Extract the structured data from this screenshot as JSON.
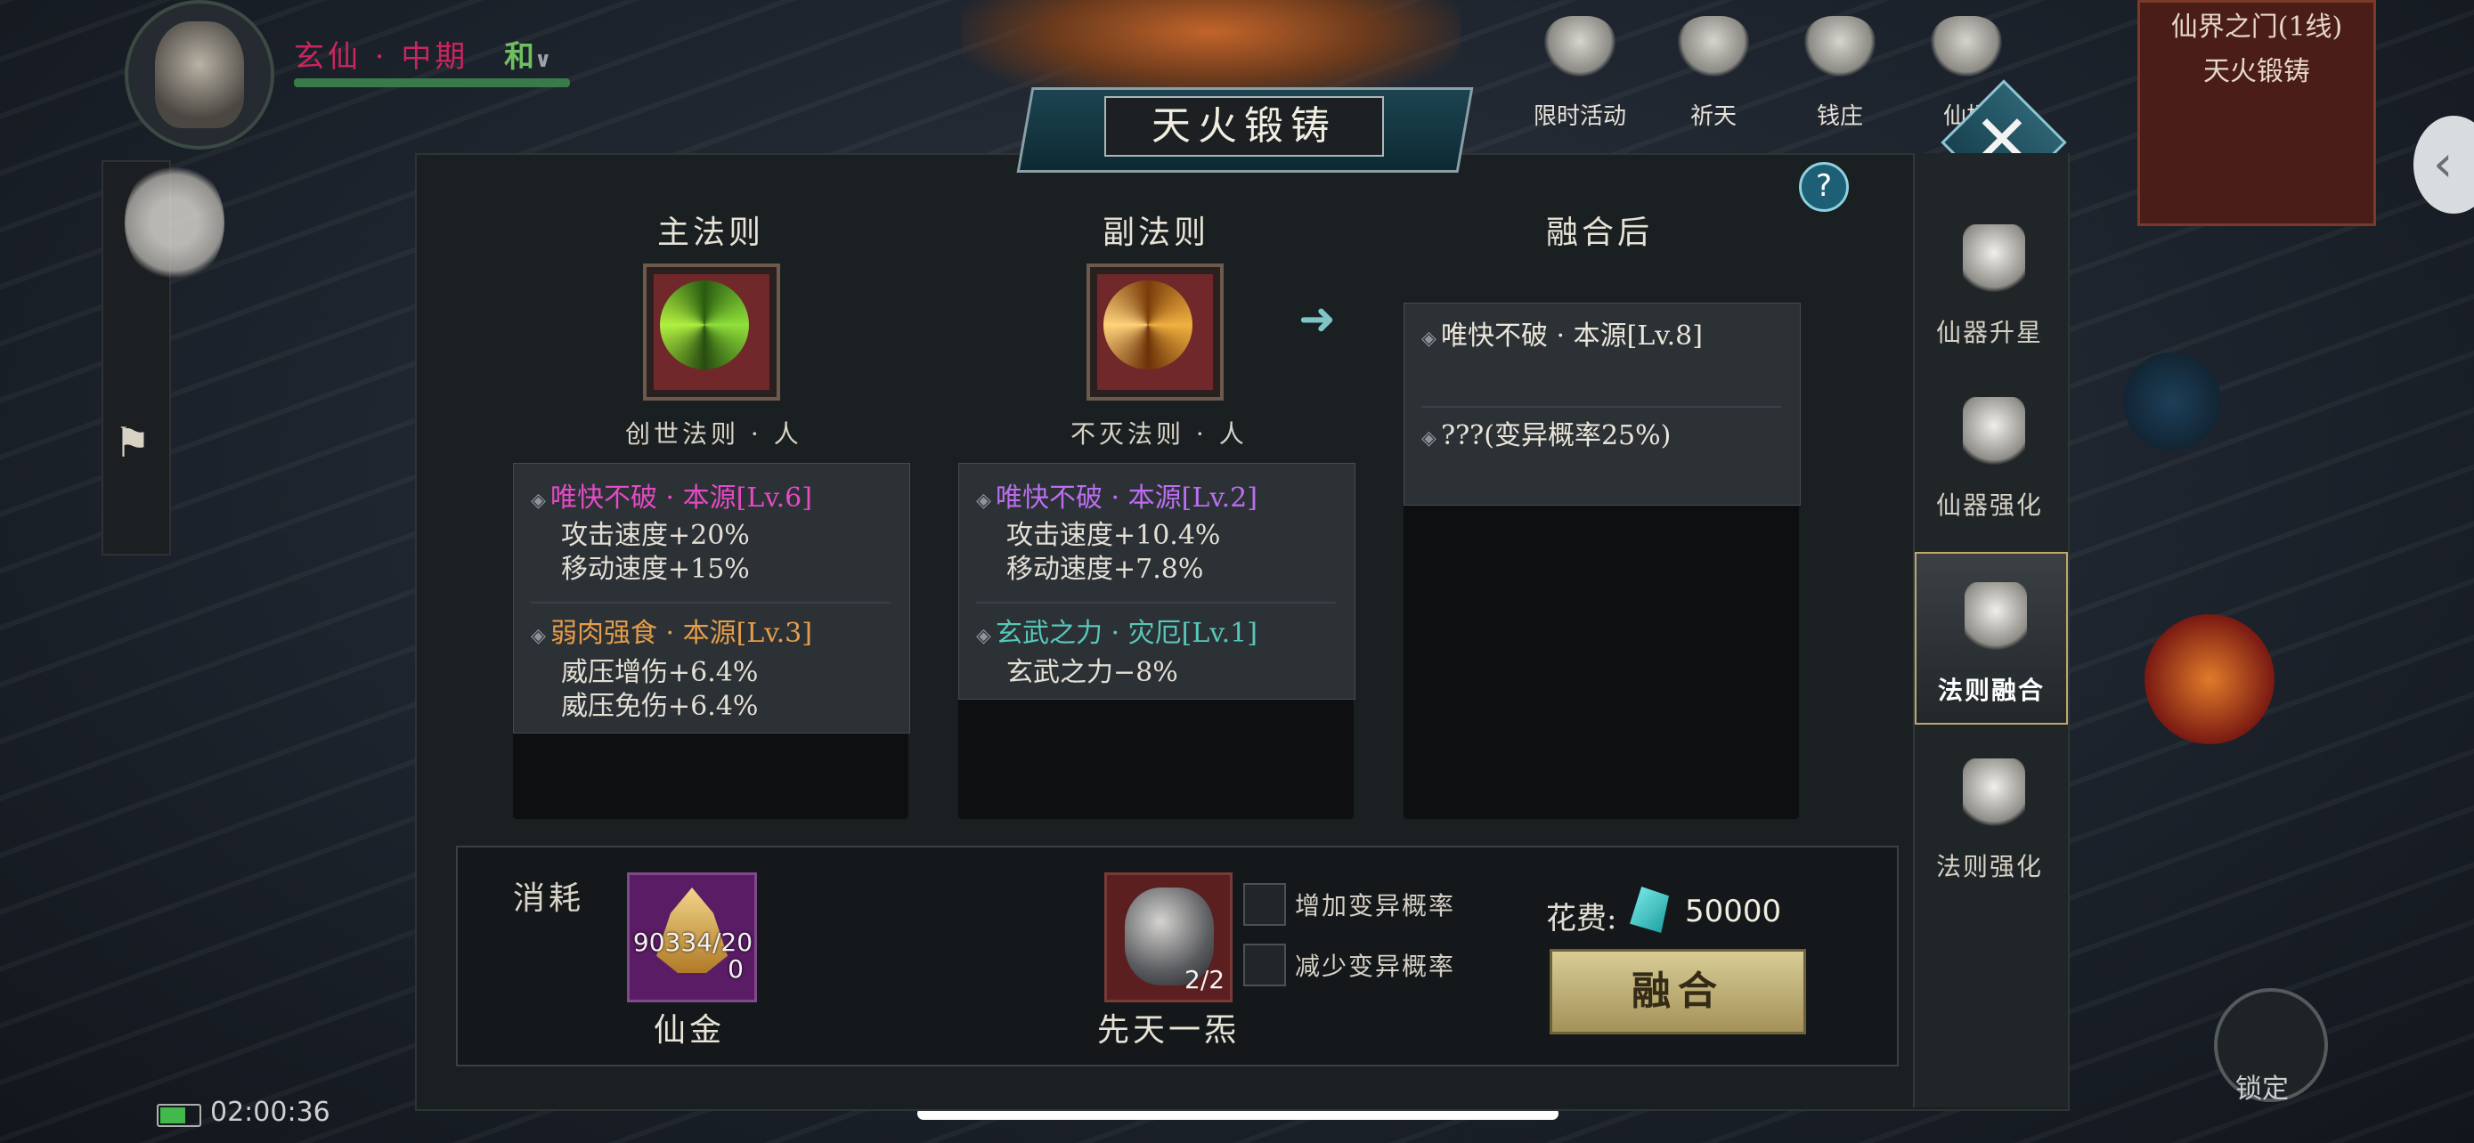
{
  "player": {
    "realm": "玄仙 · 中期",
    "mode": "和"
  },
  "top_icons": [
    {
      "name": "limited-event-icon",
      "label": "限时活动"
    },
    {
      "name": "pray-icon",
      "label": "祈天"
    },
    {
      "name": "shop-icon",
      "label": "钱庄"
    },
    {
      "name": "immortal-icon",
      "label": "仙楼"
    }
  ],
  "gate": {
    "line1": "仙界之门(1线)",
    "line2": "天火锻铸"
  },
  "dialog": {
    "title": "天火锻铸",
    "help": "?",
    "close": "✕",
    "columns": {
      "main": {
        "title": "主法则",
        "skill_name": "创世法则 · 人",
        "entries": [
          {
            "head": "唯快不破 · 本源[Lv.6]",
            "color": "#e44ac4",
            "lines": [
              "攻击速度+20%",
              "移动速度+15%"
            ]
          },
          {
            "head": "弱肉强食 · 本源[Lv.3]",
            "color": "#e59d4a",
            "lines": [
              "威压增伤+6.4%",
              "威压免伤+6.4%"
            ]
          }
        ]
      },
      "sub": {
        "title": "副法则",
        "skill_name": "不灭法则 · 人",
        "entries": [
          {
            "head": "唯快不破 · 本源[Lv.2]",
            "color": "#bb6ef0",
            "lines": [
              "攻击速度+10.4%",
              "移动速度+7.8%"
            ]
          },
          {
            "head": "玄武之力 · 灾厄[Lv.1]",
            "color": "#57c7b9",
            "lines": [
              "玄武之力−8%"
            ]
          }
        ]
      },
      "result": {
        "title": "融合后",
        "entries": [
          {
            "head": "唯快不破 · 本源[Lv.8]"
          },
          {
            "head": "???(变异概率25%)"
          }
        ]
      }
    },
    "consume": {
      "label": "消耗",
      "gold": {
        "name": "仙金",
        "count_line1": "90334/20",
        "count_line2": "0"
      },
      "stone": {
        "name": "先天一炁",
        "count": "2/2"
      },
      "options": [
        "增加变异概率",
        "减少变异概率"
      ],
      "cost_label": "花费:",
      "cost_value": "50000",
      "fuse_button": "融合"
    }
  },
  "sidebar": [
    {
      "name": "artifact-star-up",
      "label": "仙器升星",
      "active": false
    },
    {
      "name": "artifact-strengthen",
      "label": "仙器强化",
      "active": false
    },
    {
      "name": "law-fusion",
      "label": "法则融合",
      "active": true
    },
    {
      "name": "law-strengthen",
      "label": "法则强化",
      "active": false
    }
  ],
  "status": {
    "time": "02:00:36",
    "battery_level": 0.6
  },
  "lock_label": "锁定"
}
